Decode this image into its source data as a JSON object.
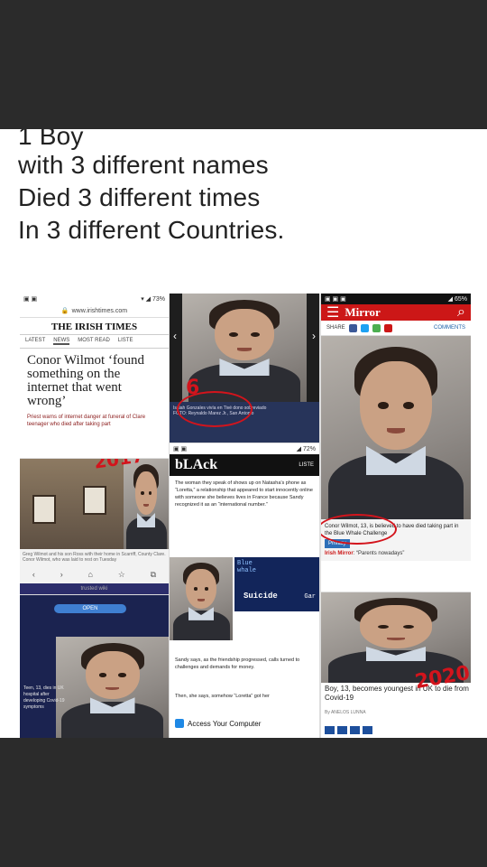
{
  "caption": {
    "lines": [
      "1 Boy",
      "with 3 different names",
      "Died 3 different times",
      "In 3 different Countries."
    ]
  },
  "irish_times": {
    "url": "www.irishtimes.com",
    "masthead": "THE IRISH TIMES",
    "nav": [
      "LATEST",
      "NEWS",
      "MOST READ",
      "LISTE"
    ],
    "headline": "Conor Wilmot ‘found something on the internet that went wrong’",
    "subline": "Priest warns of internet danger at funeral of Clare teenager who died after taking part",
    "photo_caption": "Greg Wilmot and his son Ross with their home in Scarriff, County Clare. Conor Wilmot, who was laid to rest on Tuesday",
    "year": "2017"
  },
  "photo_caption_b": {
    "text": "Isaiah Gonzales vivía en Tivé dono sobreviado",
    "credit": "FOTO: Reynaldo Marez Jr., San Antonio"
  },
  "annotation_b": "6",
  "mirror": {
    "logo": "Mirror",
    "share": "SHARE",
    "comments": "COMMENTS",
    "caption": "Conor Wilmot, 13, is believed to have died taking part in the Blue Whale Challenge",
    "privacy": "Privacy",
    "quote_source": "Irish Mirror",
    "quote": ": “Parents nowadays”"
  },
  "black": {
    "logo": "bLAck",
    "list_label": "LISTE",
    "article_1": "The woman they speak of shows up on Natasha’s phone as “Loretta,” a relationship that appeared to start innocently online with someone she believes lives in France because Sandy recognized it as an “international number.”",
    "article_2": "Sandy says, as the friendship progressed, calls turned to challenges and demands for money.",
    "article_3": "Then, she says, somehow “Loretta” got her",
    "access": "Access Your Computer",
    "bluewhale": [
      "Blue",
      "whale"
    ],
    "suicide": "Suicide",
    "game": "Gar"
  },
  "trusted": {
    "label": "trusted wiki",
    "open": "OPEN",
    "wiki_text": "Teen, 13, dies in UK hospital after developing Covid-19 symptoms"
  },
  "bottom_right": {
    "headline": "Boy, 13, becomes youngest in UK to die from Covid-19",
    "meta": "By ANELOS LUNNA",
    "year": "2020"
  }
}
